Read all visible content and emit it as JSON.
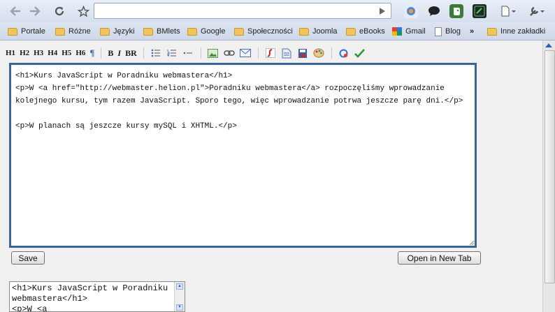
{
  "browser": {
    "url": "",
    "bookmarks": [
      {
        "label": "Portale",
        "type": "folder"
      },
      {
        "label": "Różne",
        "type": "folder"
      },
      {
        "label": "Języki",
        "type": "folder"
      },
      {
        "label": "BMlets",
        "type": "folder"
      },
      {
        "label": "Google",
        "type": "folder"
      },
      {
        "label": "Społeczności",
        "type": "folder"
      },
      {
        "label": "Joomla",
        "type": "folder"
      },
      {
        "label": "eBooks",
        "type": "folder"
      },
      {
        "label": "Gmail",
        "type": "gmail"
      },
      {
        "label": "Blog",
        "type": "page"
      },
      {
        "label": "»",
        "type": "overflow"
      },
      {
        "label": "Inne zakładki",
        "type": "folder"
      }
    ]
  },
  "toolbar": {
    "headings": [
      "H1",
      "H2",
      "H3",
      "H4",
      "H5",
      "H6"
    ],
    "paragraph": "¶",
    "bold": "B",
    "italic": "I",
    "line_break": "BR"
  },
  "editor": {
    "content": "<h1>Kurs JavaScript w Poradniku webmastera</h1>\n<p>W <a href=\"http://webmaster.helion.pl\">Poradniku webmastera</a> rozpoczęliśmy wprowadzanie kolejnego kursu, tym razem JavaScript. Sporo tego, więc wprowadzanie potrwa jeszcze parę dni.</p>\n\n<p>W planach są jeszcze kursy mySQL i XHTML.</p>"
  },
  "buttons": {
    "save": "Save",
    "open_new_tab": "Open in New Tab"
  },
  "preview": {
    "content": "<h1>Kurs JavaScript w Poradniku webmastera</h1>\n<p>W <a"
  }
}
